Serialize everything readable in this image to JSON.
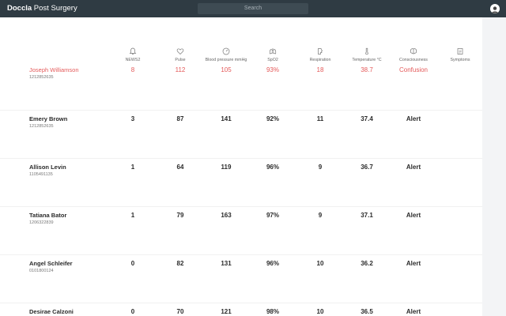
{
  "app": {
    "brand_bold": "Doccla",
    "brand_rest": " Post Surgery"
  },
  "search": {
    "placeholder": "Search"
  },
  "columns": [
    {
      "label": "NEWS2",
      "icon": "bell-icon"
    },
    {
      "label": "Pulse",
      "icon": "heart-icon"
    },
    {
      "label": "Blood pressure mmHg",
      "icon": "gauge-icon"
    },
    {
      "label": "SpO2",
      "icon": "lungs-icon"
    },
    {
      "label": "Respiration",
      "icon": "respiration-icon"
    },
    {
      "label": "Temperature °C",
      "icon": "thermometer-icon"
    },
    {
      "label": "Consciousness",
      "icon": "brain-icon"
    },
    {
      "label": "Symptoms",
      "icon": "clipboard-icon"
    }
  ],
  "patients": [
    {
      "name": "Joseph Williamson",
      "id": "1212852635",
      "news2": "8",
      "pulse": "112",
      "bp": "105",
      "spo2": "93%",
      "resp": "18",
      "temp": "38.7",
      "consciousness": "Confusion",
      "alert": true
    },
    {
      "name": "Emery Brown",
      "id": "1212852635",
      "news2": "3",
      "pulse": "87",
      "bp": "141",
      "spo2": "92%",
      "resp": "11",
      "temp": "37.4",
      "consciousness": "Alert",
      "alert": false
    },
    {
      "name": "Allison Levin",
      "id": "1105491135",
      "news2": "1",
      "pulse": "64",
      "bp": "119",
      "spo2": "96%",
      "resp": "9",
      "temp": "36.7",
      "consciousness": "Alert",
      "alert": false
    },
    {
      "name": "Tatiana Bator",
      "id": "1206322839",
      "news2": "1",
      "pulse": "79",
      "bp": "163",
      "spo2": "97%",
      "resp": "9",
      "temp": "37.1",
      "consciousness": "Alert",
      "alert": false
    },
    {
      "name": "Angel Schleifer",
      "id": "0101800124",
      "news2": "0",
      "pulse": "82",
      "bp": "131",
      "spo2": "96%",
      "resp": "10",
      "temp": "36.2",
      "consciousness": "Alert",
      "alert": false
    },
    {
      "name": "Desirae Calzoni",
      "id": "",
      "news2": "0",
      "pulse": "70",
      "bp": "121",
      "spo2": "98%",
      "resp": "10",
      "temp": "36.5",
      "consciousness": "Alert",
      "alert": false
    }
  ],
  "colors": {
    "topbar": "#2f3b43",
    "alert_red": "#e45a5a",
    "background": "#f3f4f6"
  }
}
